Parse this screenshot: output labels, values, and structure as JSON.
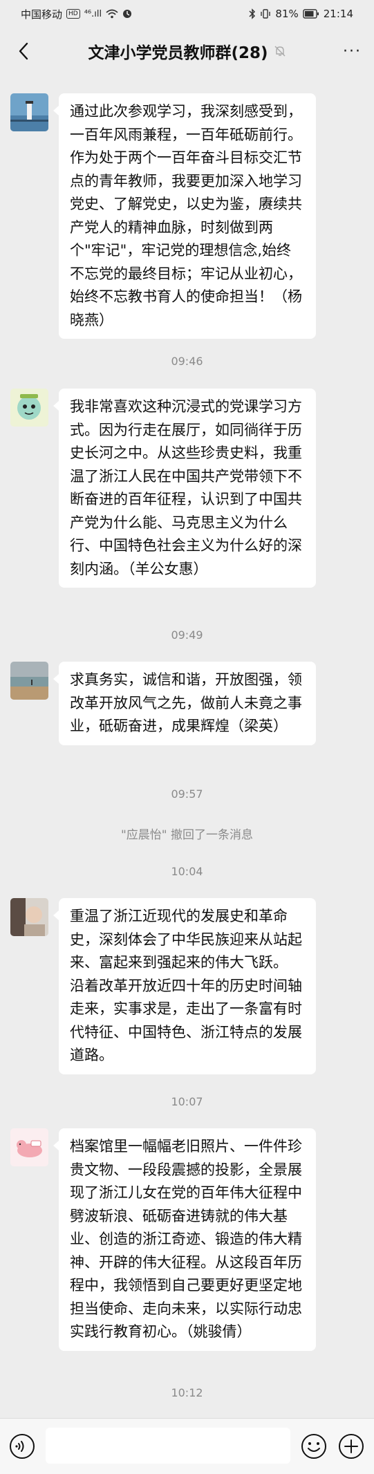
{
  "status_bar": {
    "carrier": "中国移动",
    "hd": "HD",
    "signal": "⁴⁶.ıll",
    "battery": "81%",
    "time": "21:14"
  },
  "header": {
    "title": "文津小学党员教师群(28)",
    "mute_icon": "bell-off-icon",
    "more_label": "···"
  },
  "messages": [
    {
      "text": "通过此次参观学习，我深刻感受到，一百年风雨兼程，一百年砥砺前行。作为处于两个一百年奋斗目标交汇节点的青年教师，我要更加深入地学习党史、了解党史，以史为鉴，赓续共产党人的精神血脉，时刻做到两个\"牢记\"，牢记党的理想信念,始终不忘党的最终目标；牢记从业初心，始终不忘教书育人的使命担当！（杨晓燕）"
    },
    {
      "text": "我非常喜欢这种沉浸式的党课学习方式。因为行走在展厅，如同徜徉于历史长河之中。从这些珍贵史料，我重温了浙江人民在中国共产党带领下不断奋进的百年征程，认识到了中国共产党为什么能、马克思主义为什么行、中国特色社会主义为什么好的深刻内涵。（羊公女惠）"
    },
    {
      "text": "求真务实，诚信和谐，开放图强，领改革开放风气之先，做前人未竟之事业，砥砺奋进，成果辉煌（梁英）"
    },
    {
      "text": "重温了浙江近现代的发展史和革命史，深刻体会了中华民族迎来从站起来、富起来到强起来的伟大飞跃。 沿着改革开放近四十年的历史时间轴走来，实事求是，走出了一条富有时代特征、中国特色、浙江特点的发展道路。"
    },
    {
      "text": "档案馆里一幅幅老旧照片、一件件珍贵文物、一段段震撼的投影，全景展现了浙江儿女在党的百年伟大征程中劈波斩浪、砥砺奋进铸就的伟大基业、创造的浙江奇迹、锻造的伟大精神、开辟的伟大征程。从这段百年历程中，我领悟到自己要更好更坚定地担当使命、走向未来，以实际行动忠实践行教育初心。（姚骏倩）"
    }
  ],
  "times": [
    "09:46",
    "09:49",
    "09:57",
    "10:04",
    "10:07",
    "10:12"
  ],
  "system_notice": "\"应晨怡\" 撤回了一条消息",
  "input_bar": {
    "placeholder": "",
    "voice_icon": "voice-icon",
    "emoji_icon": "emoji-icon",
    "plus_icon": "plus-icon"
  }
}
